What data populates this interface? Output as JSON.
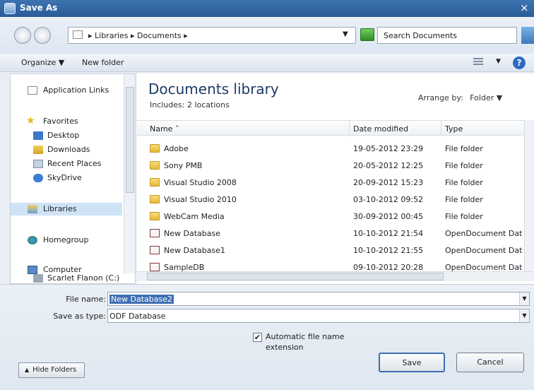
{
  "window": {
    "title": "Save As",
    "close_glyph": "×"
  },
  "address": {
    "path": "▸ Libraries ▸ Documents ▸",
    "dropdown_glyph": "▼",
    "search_placeholder": "Search Documents"
  },
  "toolbar": {
    "organize_label": "Organize ▼",
    "new_folder_label": "New folder",
    "help_glyph": "?"
  },
  "nav": {
    "items": [
      {
        "label": "Application Links"
      },
      {
        "label": "Favorites"
      },
      {
        "label": "Desktop"
      },
      {
        "label": "Downloads"
      },
      {
        "label": "Recent Places"
      },
      {
        "label": "SkyDrive"
      },
      {
        "label": "Libraries"
      },
      {
        "label": "Homegroup"
      },
      {
        "label": "Computer"
      },
      {
        "label": "Scarlet Flanon (C:)"
      }
    ]
  },
  "library": {
    "title": "Documents library",
    "subtitle": "Includes: 2 locations",
    "arrange_by_label": "Arrange by:",
    "arrange_by_value": "Folder ▼"
  },
  "columns": {
    "name": "Name ˆ",
    "date_modified": "Date modified",
    "type": "Type"
  },
  "files": [
    {
      "name": "Adobe",
      "date": "19-05-2012 23:29",
      "type": "File folder",
      "kind": "folder"
    },
    {
      "name": "Sony PMB",
      "date": "20-05-2012 12:25",
      "type": "File folder",
      "kind": "folder"
    },
    {
      "name": "Visual Studio 2008",
      "date": "20-09-2012 15:23",
      "type": "File folder",
      "kind": "folder"
    },
    {
      "name": "Visual Studio 2010",
      "date": "03-10-2012 09:52",
      "type": "File folder",
      "kind": "folder"
    },
    {
      "name": "WebCam Media",
      "date": "30-09-2012 00:45",
      "type": "File folder",
      "kind": "folder"
    },
    {
      "name": "New Database",
      "date": "10-10-2012 21:54",
      "type": "OpenDocument Dat...",
      "kind": "db"
    },
    {
      "name": "New Database1",
      "date": "10-10-2012 21:55",
      "type": "OpenDocument Dat...",
      "kind": "db"
    },
    {
      "name": "SampleDB",
      "date": "09-10-2012 20:28",
      "type": "OpenDocument Dat...",
      "kind": "db"
    }
  ],
  "form": {
    "file_name_label": "File name:",
    "file_name_value": "New Database2",
    "save_type_label": "Save as type:",
    "save_type_value": "ODF Database",
    "auto_ext_checked": "✔",
    "auto_ext_label": "Automatic file name extension",
    "save_label": "Save",
    "cancel_label": "Cancel",
    "hide_folders_label": "Hide Folders"
  }
}
